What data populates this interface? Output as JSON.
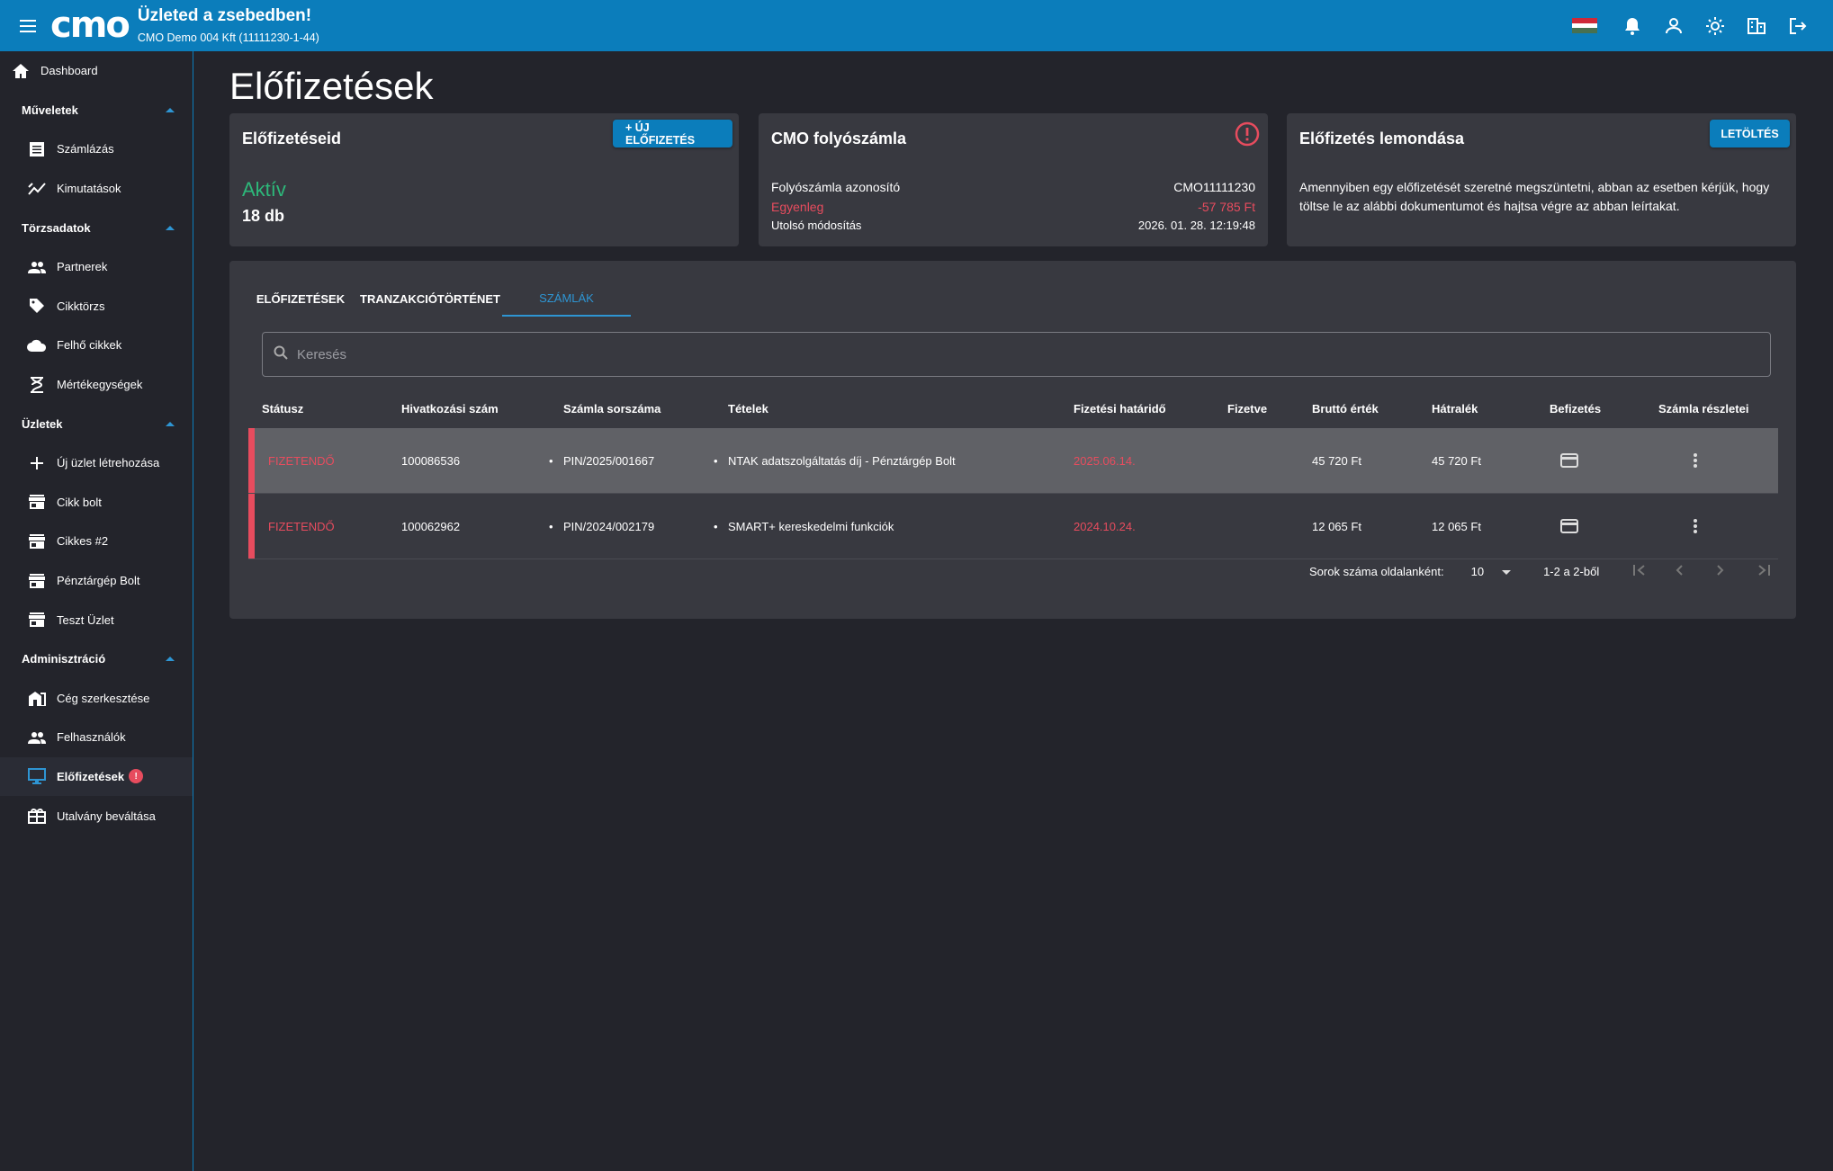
{
  "app": {
    "logo": "cmo",
    "title": "Üzleted a zsebedben!",
    "company": "CMO Demo 004 Kft (11111230-1-44)"
  },
  "sidebar": {
    "dashboard": "Dashboard",
    "sections": {
      "muveletek": "Műveletek",
      "torzsadatok": "Törzsadatok",
      "uzletek": "Üzletek",
      "admin": "Adminisztráció"
    },
    "items": {
      "szamlazas": "Számlázás",
      "kimutatasok": "Kimutatások",
      "partnerek": "Partnerek",
      "cikktorzs": "Cikktörzs",
      "felho": "Felhő cikkek",
      "mertekegysegek": "Mértékegységek",
      "uj_uzlet": "Új üzlet létrehozása",
      "cikk_bolt": "Cikk bolt",
      "cikkes2": "Cikkes #2",
      "penztargep": "Pénztárgép Bolt",
      "teszt": "Teszt Üzlet",
      "ceg": "Cég szerkesztése",
      "felhasznalok": "Felhasználók",
      "elofizetesek": "Előfizetések",
      "utalvany": "Utalvány beváltása"
    }
  },
  "page": {
    "title": "Előfizetések"
  },
  "cards": {
    "subs": {
      "title": "Előfizetéseid",
      "button": "+ ÚJ ELŐFIZETÉS",
      "status": "Aktív",
      "count": "18 db"
    },
    "account": {
      "title": "CMO folyószámla",
      "id_label": "Folyószámla azonosító",
      "id_value": "CMO11111230",
      "balance_label": "Egyenleg",
      "balance_value": "-57 785 Ft",
      "modified_label": "Utolsó módosítás",
      "modified_value": "2026. 01. 28. 12:19:48"
    },
    "cancel": {
      "title": "Előfizetés lemondása",
      "button": "LETÖLTÉS",
      "text": "Amennyiben egy előfizetését szeretné megszüntetni, abban az esetben kérjük, hogy töltse le az alábbi dokumentumot és hajtsa végre az abban leírtakat."
    }
  },
  "tabs": [
    "ELŐFIZETÉSEK",
    "TRANZAKCIÓTÖRTÉNET",
    "SZÁMLÁK"
  ],
  "search": {
    "placeholder": "Keresés"
  },
  "table": {
    "headers": [
      "Státusz",
      "Hivatkozási szám",
      "Számla sorszáma",
      "Tételek",
      "Fizetési határidő",
      "Fizetve",
      "Bruttó érték",
      "Hátralék",
      "Befizetés",
      "Számla részletei"
    ],
    "rows": [
      {
        "status": "FIZETENDŐ",
        "ref": "100086536",
        "invoice": "PIN/2025/001667",
        "items": "NTAK adatszolgáltatás díj - Pénztárgép Bolt",
        "due": "2025.06.14.",
        "paid": "",
        "gross": "45 720 Ft",
        "remaining": "45 720 Ft"
      },
      {
        "status": "FIZETENDŐ",
        "ref": "100062962",
        "invoice": "PIN/2024/002179",
        "items": "SMART+ kereskedelmi funkciók",
        "due": "2024.10.24.",
        "paid": "",
        "gross": "12 065 Ft",
        "remaining": "12 065 Ft"
      }
    ]
  },
  "pager": {
    "rows_label": "Sorok száma oldalanként:",
    "rows_value": "10",
    "range": "1-2 a 2-ből"
  },
  "colors": {
    "brand": "#0b7dbb",
    "danger": "#e74c5e",
    "success": "#2db87a"
  }
}
